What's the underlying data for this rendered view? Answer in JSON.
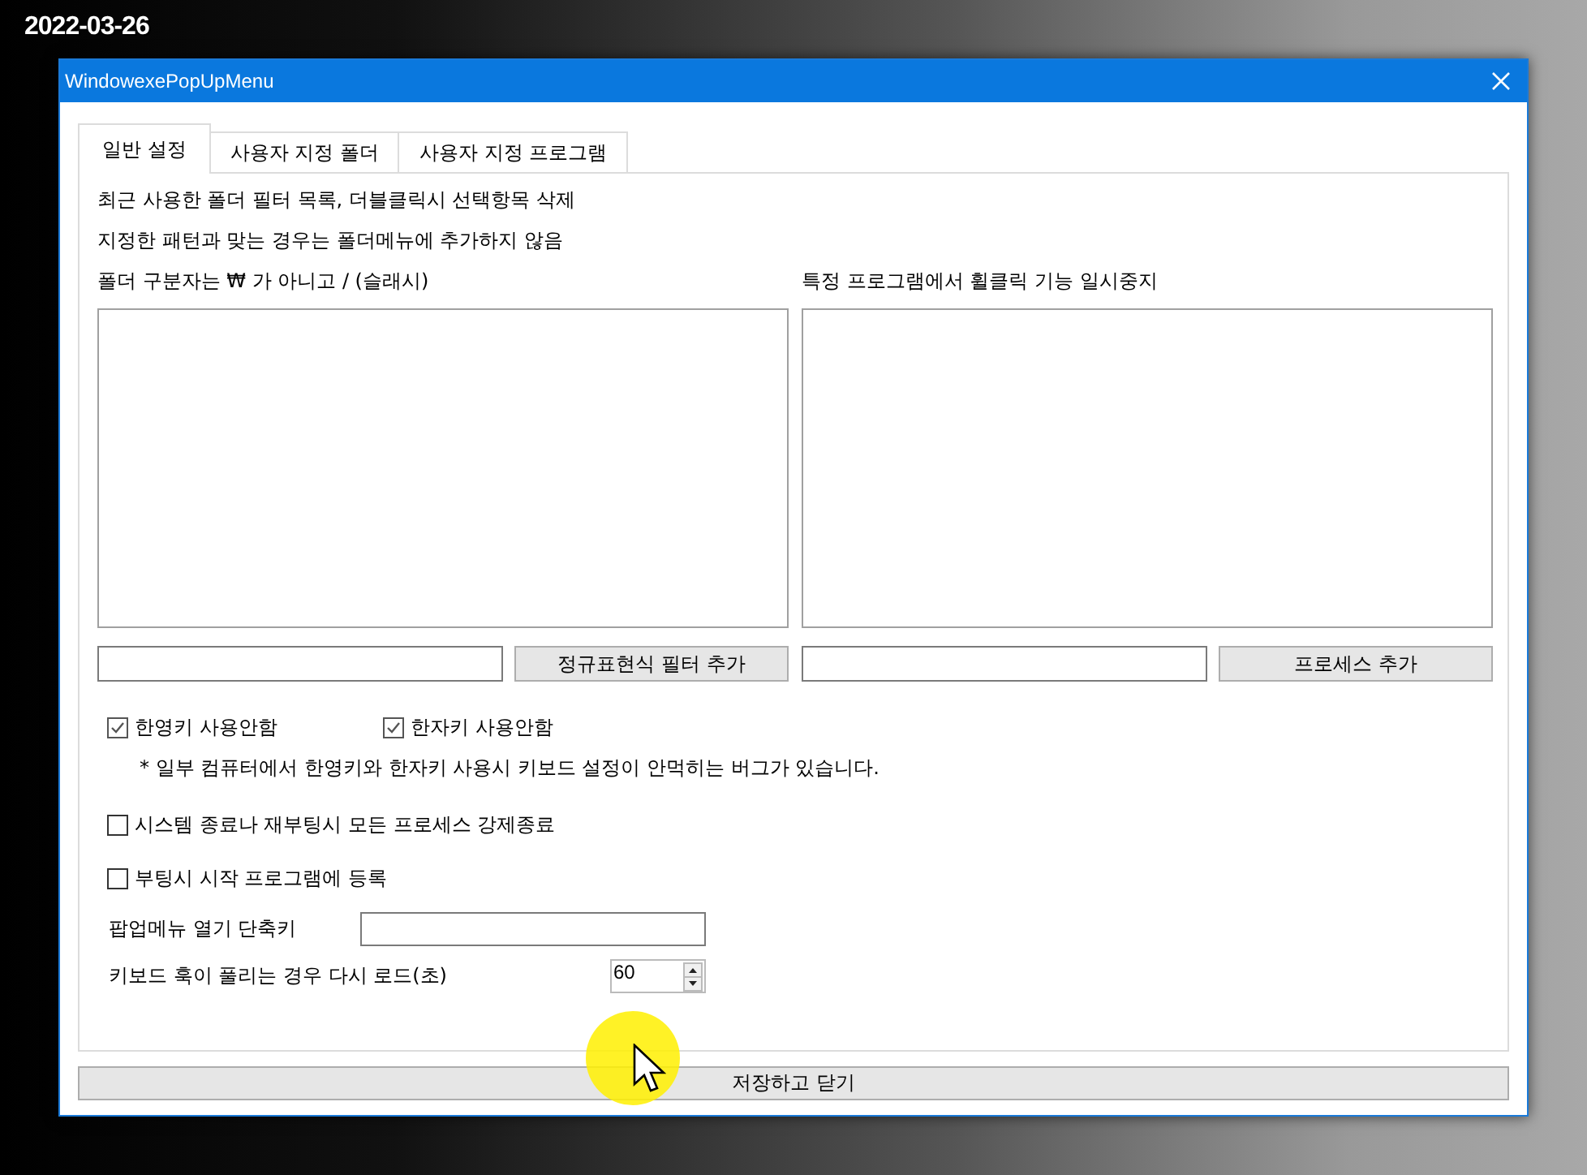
{
  "desktop": {
    "date": "2022-03-26"
  },
  "window": {
    "title": "WindowexePopUpMenu"
  },
  "tabs": [
    {
      "label": "일반 설정",
      "selected": true
    },
    {
      "label": "사용자 지정 폴더",
      "selected": false
    },
    {
      "label": "사용자 지정 프로그램",
      "selected": false
    }
  ],
  "info_lines": [
    "최근 사용한 폴더 필터 목록, 더블클릭시 선택항목 삭제",
    "지정한 패턴과 맞는 경우는 폴더메뉴에 추가하지 않음",
    "폴더 구분자는 ₩ 가 아니고 / (슬래시)"
  ],
  "right_label": "특정 프로그램에서 휠클릭 기능 일시중지",
  "filter_button": "정규표현식 필터 추가",
  "process_button": "프로세스 추가",
  "key_options": [
    {
      "label": "한영키 사용안함",
      "checked": true
    },
    {
      "label": "한자키 사용안함",
      "checked": true
    }
  ],
  "note": "* 일부 컴퓨터에서 한영키와 한자키 사용시 키보드 설정이 안먹히는 버그가 있습니다.",
  "options": [
    {
      "label": "시스템 종료나 재부팅시 모든 프로세스 강제종료",
      "checked": false
    },
    {
      "label": "부팅시 시작 프로그램에 등록",
      "checked": false
    }
  ],
  "shortcut": {
    "label": "팝업메뉴 열기 단축키"
  },
  "reload": {
    "label": "키보드 훅이 풀리는 경우 다시 로드(초)",
    "value": "60"
  },
  "save_button": "저장하고 닫기"
}
